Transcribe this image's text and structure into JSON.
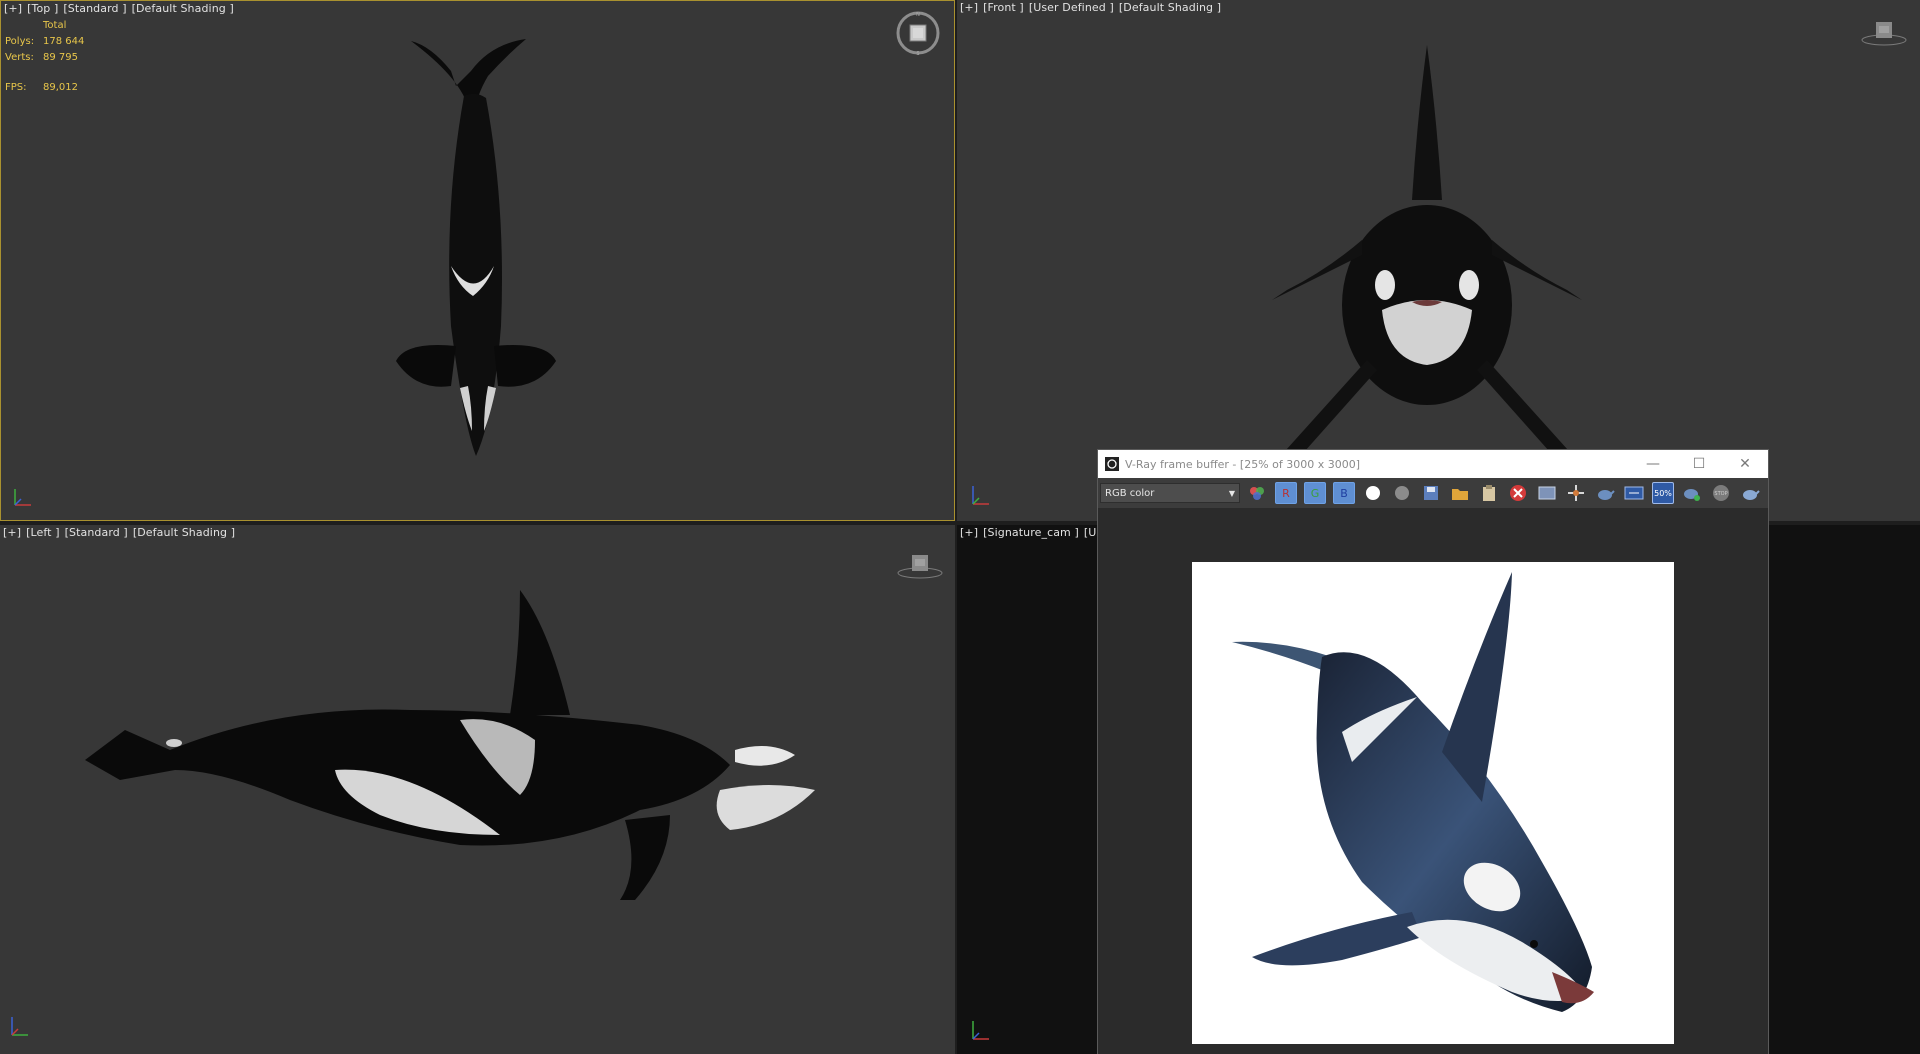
{
  "viewports": {
    "top": {
      "labels": [
        "[+]",
        "[Top ]",
        "[Standard ]",
        "[Default Shading ]"
      ],
      "stats": {
        "total_label": "Total",
        "polys_label": "Polys:",
        "polys_value": "178 644",
        "verts_label": "Verts:",
        "verts_value": "89 795",
        "fps_label": "FPS:",
        "fps_value": "89,012"
      }
    },
    "front": {
      "labels": [
        "[+]",
        "[Front ]",
        "[User Defined ]",
        "[Default Shading ]"
      ]
    },
    "left": {
      "labels": [
        "[+]",
        "[Left ]",
        "[Standard ]",
        "[Default Shading ]"
      ]
    },
    "camera": {
      "labels": [
        "[+]",
        "[Signature_cam ]",
        "[User"
      ]
    }
  },
  "vfb": {
    "title": "V-Ray frame buffer - [25% of 3000 x 3000]",
    "channel": "RGB color",
    "channel_buttons": [
      "R",
      "G",
      "B"
    ],
    "toolbar_icons": [
      "color-mode-icon",
      "r-channel-icon",
      "g-channel-icon",
      "b-channel-icon",
      "white-dot-icon",
      "gray-sphere-icon",
      "save-icon",
      "open-folder-icon",
      "clipboard-icon",
      "clear-icon",
      "region-render-icon",
      "track-mouse-icon",
      "teapot-icon",
      "compare-icon",
      "zoom-50-icon",
      "render-teapot-icon",
      "stop-icon",
      "teapot-alt-icon"
    ],
    "zoom_label": "50%",
    "stop_label": "STOP"
  },
  "colors": {
    "selected_viewport_border": "#a9912f",
    "stats_text": "#e8c64a",
    "rgb_button": "#5f8fd2"
  }
}
